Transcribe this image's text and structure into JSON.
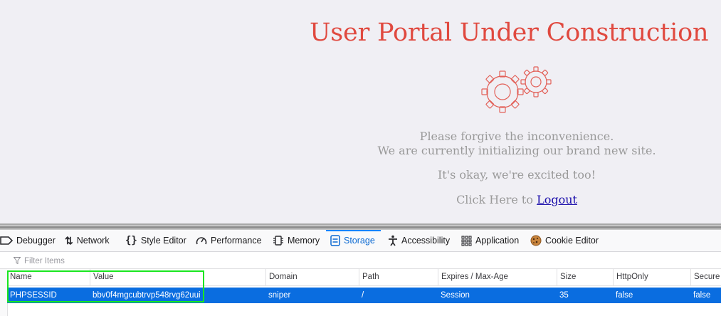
{
  "page": {
    "title": "User Portal Under Construction",
    "line1": "Please forgive the inconvenience.",
    "line2": "We are currently initializing our brand new site.",
    "line3": "It's okay, we're excited too!",
    "line4_prefix": "Click Here to ",
    "logout_link": "Logout",
    "accent_color": "#e0493f"
  },
  "devtools": {
    "tabs": [
      {
        "label": "Debugger",
        "icon": "debugger-icon"
      },
      {
        "label": "Network",
        "icon": "network-icon"
      },
      {
        "label": "Style Editor",
        "icon": "style-editor-icon"
      },
      {
        "label": "Performance",
        "icon": "performance-icon"
      },
      {
        "label": "Memory",
        "icon": "memory-icon"
      },
      {
        "label": "Storage",
        "icon": "storage-icon",
        "selected": true
      },
      {
        "label": "Accessibility",
        "icon": "accessibility-icon"
      },
      {
        "label": "Application",
        "icon": "application-icon"
      },
      {
        "label": "Cookie Editor",
        "icon": "cookie-icon"
      }
    ],
    "filter_placeholder": "Filter Items",
    "columns": [
      "Name",
      "Value",
      "Domain",
      "Path",
      "Expires / Max-Age",
      "Size",
      "HttpOnly",
      "Secure"
    ],
    "rows": [
      {
        "name": "PHPSESSID",
        "value": "bbv0f4mgcubtrvp548rvg62uui",
        "domain": "sniper",
        "path": "/",
        "expires": "Session",
        "size": "35",
        "httponly": "false",
        "secure": "false",
        "selected": true
      }
    ],
    "selection_color": "#0a6de0",
    "highlight_color": "#19e61f"
  }
}
